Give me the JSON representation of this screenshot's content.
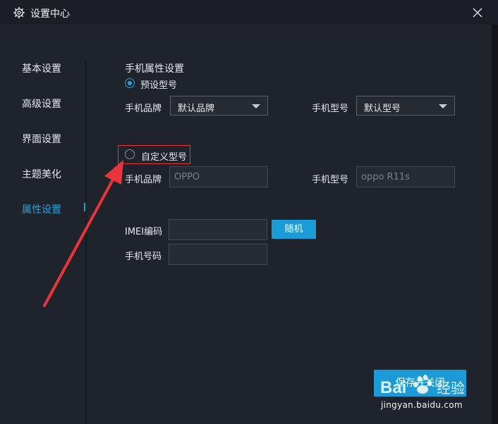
{
  "window": {
    "title": "设置中心",
    "settings_icon": "gear-icon",
    "close_icon": "close-icon"
  },
  "sidebar": {
    "items": [
      {
        "label": "基本设置",
        "active": false
      },
      {
        "label": "高级设置",
        "active": false
      },
      {
        "label": "界面设置",
        "active": false
      },
      {
        "label": "主题美化",
        "active": false
      },
      {
        "label": "属性设置",
        "active": true
      }
    ]
  },
  "phone_props": {
    "section_title": "手机属性设置",
    "preset": {
      "label": "预设型号",
      "selected": true,
      "brand_label": "手机品牌",
      "brand_value": "默认品牌",
      "model_label": "手机型号",
      "model_value": "默认型号"
    },
    "custom": {
      "label": "自定义型号",
      "selected": false,
      "brand_label": "手机品牌",
      "brand_placeholder": "OPPO",
      "model_label": "手机型号",
      "model_placeholder": "oppo R11s"
    },
    "imei_label": "IMEI编码",
    "imei_value": "",
    "random_button": "随机",
    "phone_number_label": "手机号码",
    "phone_number_value": ""
  },
  "footer": {
    "save_close_button": "保存并关闭"
  },
  "colors": {
    "accent": "#26a3dd",
    "button": "#1a9bd7",
    "highlight_box": "#e8343a",
    "annotation_arrow": "#e8343a",
    "background": "#1f232b"
  },
  "watermark": {
    "text": "jingyan.baidu.com"
  }
}
